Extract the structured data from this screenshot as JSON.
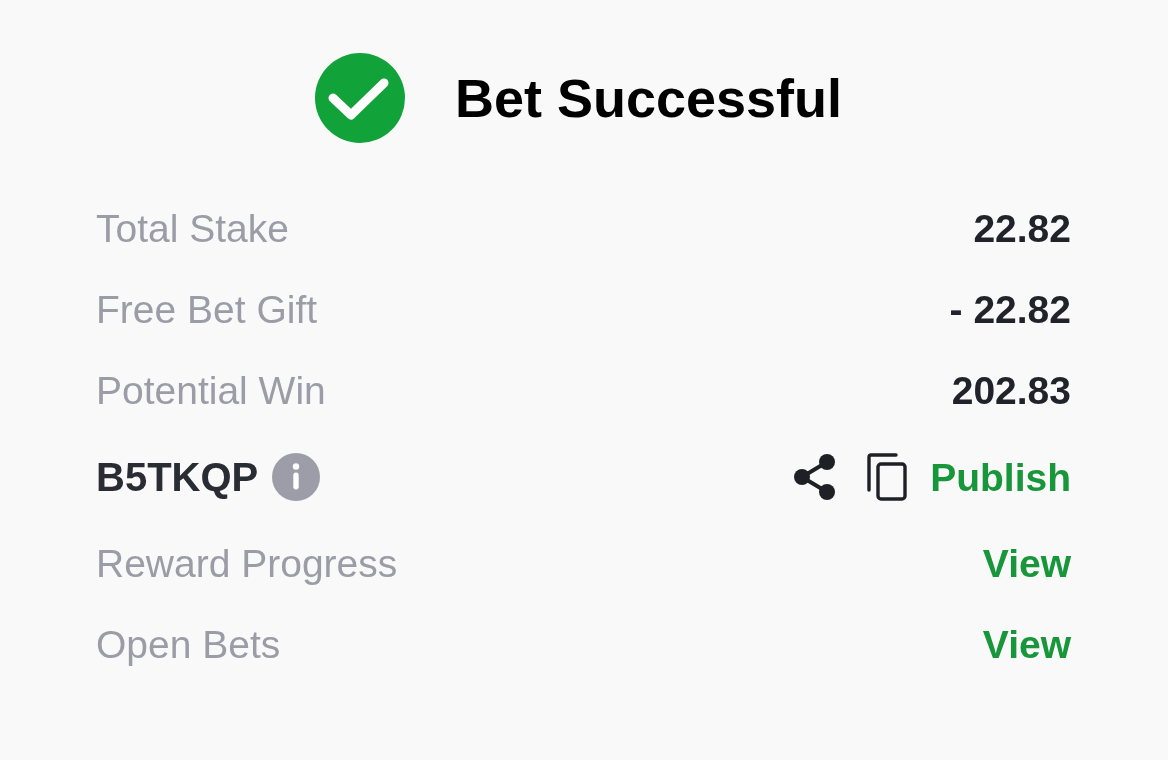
{
  "header": {
    "title": "Bet Successful"
  },
  "rows": [
    {
      "kind": "amount",
      "label": "Total Stake",
      "value": "22.82"
    },
    {
      "kind": "amount",
      "label": "Free Bet Gift",
      "value": "- 22.82"
    },
    {
      "kind": "amount",
      "label": "Potential Win",
      "value": "202.83"
    },
    {
      "kind": "code",
      "code": "B5TKQP",
      "action": "Publish"
    },
    {
      "kind": "link",
      "label": "Reward Progress",
      "link": "View"
    },
    {
      "kind": "link",
      "label": "Open Bets",
      "link": "View"
    }
  ]
}
